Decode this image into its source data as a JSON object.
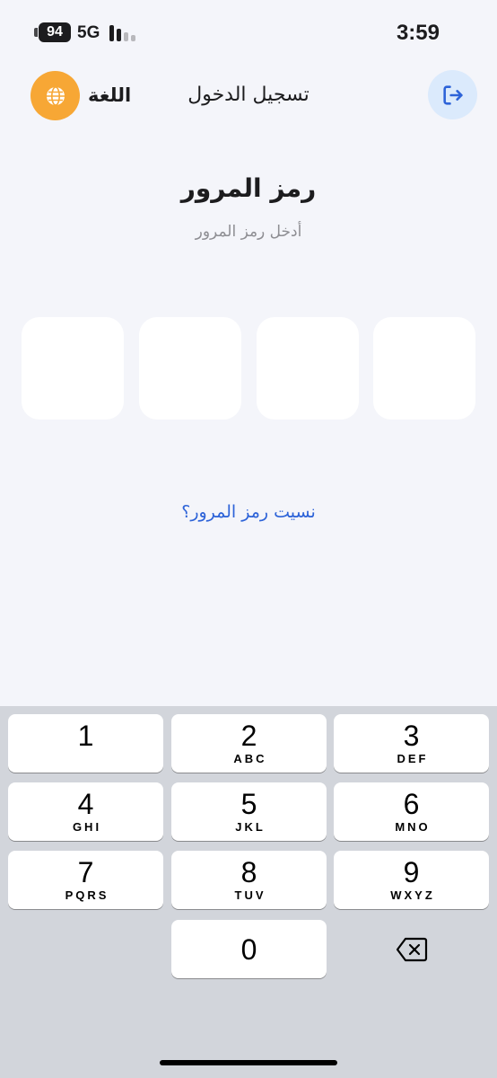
{
  "status_bar": {
    "battery": "94",
    "network": "5G",
    "time": "3:59",
    "signal_colors": [
      "#1c1c1e",
      "#1c1c1e",
      "#b8b8bc",
      "#b8b8bc"
    ]
  },
  "header": {
    "language_label": "اللغة",
    "title": "تسجيل الدخول",
    "language_icon": "globe-icon",
    "exit_icon": "logout-icon"
  },
  "content": {
    "title": "رمز المرور",
    "subtitle": "أدخل رمز المرور",
    "pin_length": 4,
    "forgot_link": "نسيت رمز المرور؟"
  },
  "keypad": {
    "keys": [
      {
        "digit": "1",
        "letters": ""
      },
      {
        "digit": "2",
        "letters": "ABC"
      },
      {
        "digit": "3",
        "letters": "DEF"
      },
      {
        "digit": "4",
        "letters": "GHI"
      },
      {
        "digit": "5",
        "letters": "JKL"
      },
      {
        "digit": "6",
        "letters": "MNO"
      },
      {
        "digit": "7",
        "letters": "PQRS"
      },
      {
        "digit": "8",
        "letters": "TUV"
      },
      {
        "digit": "9",
        "letters": "WXYZ"
      }
    ],
    "zero": "0",
    "delete_icon": "backspace-icon"
  },
  "colors": {
    "accent_orange": "#f7a735",
    "link_blue": "#2d63d8",
    "exit_bg": "#dbeafc",
    "exit_icon": "#2d63d8"
  }
}
